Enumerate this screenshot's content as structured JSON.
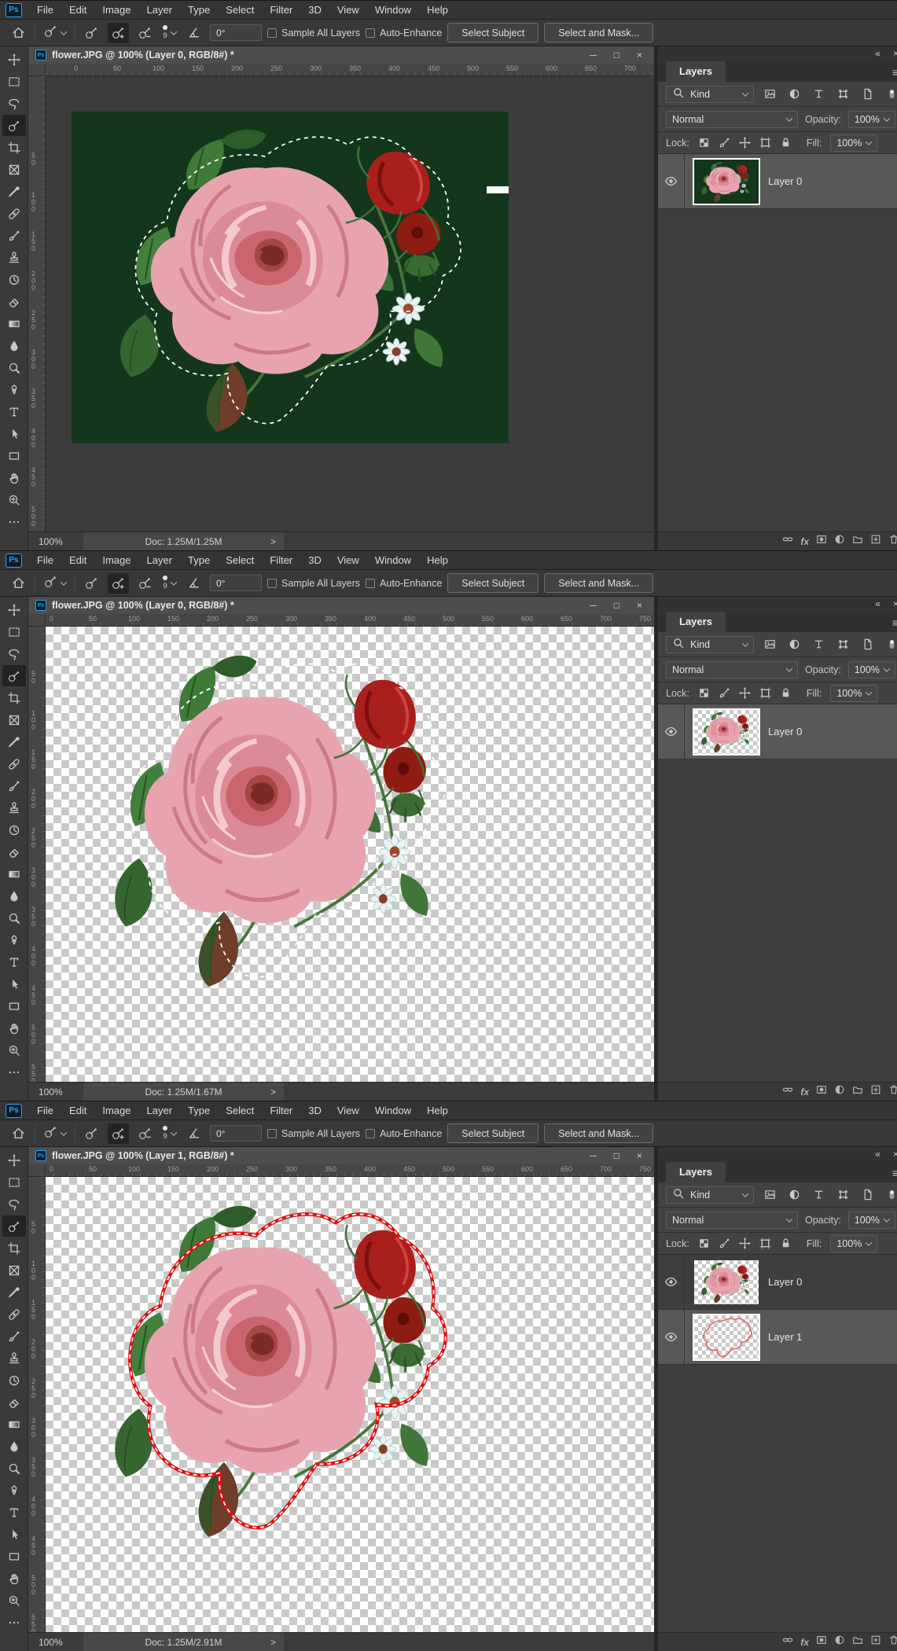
{
  "app": {
    "name": "Adobe Photoshop",
    "logo_text": "Ps",
    "menu": [
      "File",
      "Edit",
      "Image",
      "Layer",
      "Type",
      "Select",
      "Filter",
      "3D",
      "View",
      "Window",
      "Help"
    ],
    "window_controls": [
      {
        "name": "minimize",
        "glyph": "─"
      },
      {
        "name": "maximize",
        "glyph": "□"
      },
      {
        "name": "close",
        "glyph": "×"
      }
    ],
    "options_bar": {
      "brush_size": "9",
      "angle_value": "0°",
      "sample_all_layers_label": "Sample All Layers",
      "auto_enhance_label": "Auto-Enhance",
      "select_subject_label": "Select Subject",
      "select_and_mask_label": "Select and Mask..."
    },
    "tools": [
      {
        "name": "move"
      },
      {
        "name": "rectangular-marquee"
      },
      {
        "name": "lasso"
      },
      {
        "name": "quick-selection",
        "active": true
      },
      {
        "name": "crop"
      },
      {
        "name": "frame"
      },
      {
        "name": "eyedropper"
      },
      {
        "name": "spot-healing"
      },
      {
        "name": "brush"
      },
      {
        "name": "clone-stamp"
      },
      {
        "name": "history-brush"
      },
      {
        "name": "eraser"
      },
      {
        "name": "gradient"
      },
      {
        "name": "blur"
      },
      {
        "name": "dodge"
      },
      {
        "name": "pen"
      },
      {
        "name": "type"
      },
      {
        "name": "path-selection"
      },
      {
        "name": "rectangle"
      },
      {
        "name": "hand"
      },
      {
        "name": "zoom"
      },
      {
        "name": "edit-toolbar"
      }
    ]
  },
  "rulers": {
    "h_labels": [
      "0",
      "50",
      "100",
      "150",
      "200",
      "250",
      "300",
      "350",
      "400",
      "450",
      "500",
      "550",
      "600",
      "650",
      "700",
      "750"
    ],
    "v_labels": [
      "50",
      "100",
      "150",
      "200",
      "250",
      "300",
      "350",
      "400",
      "450",
      "500",
      "550"
    ]
  },
  "layers_panel": {
    "collapse_glyph": "«",
    "close_glyph": "×",
    "tab_label": "Layers",
    "menu_glyph": "≡",
    "filter_label": "Kind",
    "blend_mode": "Normal",
    "opacity_label": "Opacity:",
    "opacity_value": "100%",
    "lock_label": "Lock:",
    "fill_label": "Fill:",
    "fill_value": "100%"
  },
  "status_chevron": ">",
  "panels": [
    {
      "title": "flower.JPG @ 100% (Layer 0, RGB/8#) *",
      "canvas": "green",
      "status": {
        "zoom": "100%",
        "doc": "Doc: 1.25M/1.25M"
      },
      "layers": [
        {
          "name": "Layer 0",
          "selected": true,
          "thumb": "rose-green"
        }
      ]
    },
    {
      "title": "flower.JPG @ 100% (Layer 0, RGB/8#) *",
      "canvas": "transparent",
      "status": {
        "zoom": "100%",
        "doc": "Doc: 1.25M/1.67M"
      },
      "layers": [
        {
          "name": "Layer 0",
          "selected": true,
          "thumb": "rose-trans"
        }
      ]
    },
    {
      "title": "flower.JPG @ 100% (Layer 1, RGB/8#) *",
      "canvas": "transparent-red",
      "status": {
        "zoom": "100%",
        "doc": "Doc: 1.25M/2.91M"
      },
      "layers": [
        {
          "name": "Layer 0",
          "selected": false,
          "thumb": "rose-trans"
        },
        {
          "name": "Layer 1",
          "selected": true,
          "thumb": "outline"
        }
      ]
    }
  ],
  "colors": {
    "canvas_background_green": "#14371c",
    "selection_outline_red": "#e01010",
    "marching_ants": "#ffffff",
    "accent_blue": "#31a8ff"
  }
}
